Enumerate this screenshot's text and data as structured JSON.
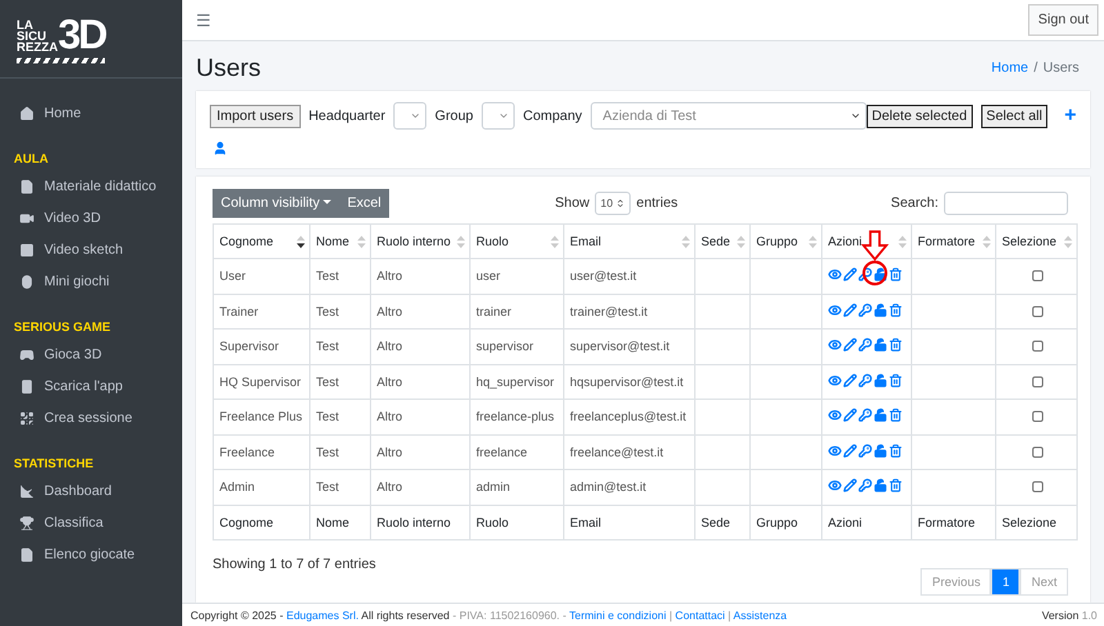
{
  "logo": {
    "lines": [
      "LA",
      "SICU",
      "REZZA"
    ],
    "mark": "3D"
  },
  "sidebar": {
    "home": {
      "label": "Home"
    },
    "sections": [
      {
        "title": "AULA",
        "items": [
          {
            "label": "Materiale didattico"
          },
          {
            "label": "Video 3D"
          },
          {
            "label": "Video sketch"
          },
          {
            "label": "Mini giochi"
          }
        ]
      },
      {
        "title": "SERIOUS GAME",
        "items": [
          {
            "label": "Gioca 3D"
          },
          {
            "label": "Scarica l'app"
          },
          {
            "label": "Crea sessione"
          }
        ]
      },
      {
        "title": "STATISTICHE",
        "items": [
          {
            "label": "Dashboard"
          },
          {
            "label": "Classifica"
          },
          {
            "label": "Elenco giocate"
          }
        ]
      }
    ]
  },
  "topbar": {
    "menu": "☰",
    "signout": "Sign out"
  },
  "page": {
    "title": "Users",
    "breadcrumb": [
      {
        "label": "Home",
        "link": true
      },
      {
        "label": "Users",
        "link": false
      }
    ],
    "separator": "/"
  },
  "filters": {
    "import": "Import users",
    "headquarter": {
      "label": "Headquarter"
    },
    "group": {
      "label": "Group"
    },
    "company": {
      "label": "Company",
      "value": "Azienda di Test"
    },
    "delete": "Delete selected",
    "select_all": "Select all",
    "add": "+"
  },
  "table_tools": {
    "buttons": [
      "Column visibility",
      "Excel"
    ],
    "show": "Show",
    "length": "10",
    "entries": "entries",
    "search": "Search:"
  },
  "table": {
    "columns": [
      {
        "label": "Cognome",
        "sorted": true
      },
      {
        "label": "Nome",
        "sorted": false
      },
      {
        "label": "Ruolo interno",
        "sorted": false
      },
      {
        "label": "Ruolo",
        "sorted": false
      },
      {
        "label": "Email",
        "sorted": false
      },
      {
        "label": "Sede",
        "sorted": false
      },
      {
        "label": "Gruppo",
        "sorted": false
      },
      {
        "label": "Azioni",
        "sorted": false
      },
      {
        "label": "Formatore",
        "sorted": false
      },
      {
        "label": "Selezione",
        "sorted": false
      }
    ],
    "rows": [
      {
        "cognome": "User",
        "nome": "Test",
        "ruolo_interno": "Altro",
        "ruolo": "user",
        "email": "user@test.it",
        "selected": false,
        "annotated": true
      },
      {
        "cognome": "Trainer",
        "nome": "Test",
        "ruolo_interno": "Altro",
        "ruolo": "trainer",
        "email": "trainer@test.it",
        "selected": false,
        "annotated": false
      },
      {
        "cognome": "Supervisor",
        "nome": "Test",
        "ruolo_interno": "Altro",
        "ruolo": "supervisor",
        "email": "supervisor@test.it",
        "selected": false,
        "annotated": false
      },
      {
        "cognome": "HQ Supervisor",
        "nome": "Test",
        "ruolo_interno": "Altro",
        "ruolo": "hq_supervisor",
        "email": "hqsupervisor@test.it",
        "selected": false,
        "annotated": false
      },
      {
        "cognome": "Freelance Plus",
        "nome": "Test",
        "ruolo_interno": "Altro",
        "ruolo": "freelance-plus",
        "email": "freelanceplus@test.it",
        "selected": false,
        "annotated": false
      },
      {
        "cognome": "Freelance",
        "nome": "Test",
        "ruolo_interno": "Altro",
        "ruolo": "freelance",
        "email": "freelance@test.it",
        "selected": false,
        "annotated": false
      },
      {
        "cognome": "Admin",
        "nome": "Test",
        "ruolo_interno": "Altro",
        "ruolo": "admin",
        "email": "admin@test.it",
        "selected": false,
        "annotated": false
      }
    ],
    "footer_columns": [
      "Cognome",
      "Nome",
      "Ruolo interno",
      "Ruolo",
      "Email",
      "Sede",
      "Gruppo",
      "Azioni",
      "Formatore",
      "Selezione"
    ],
    "info": "Showing 1 to 7 of 7 entries",
    "pagination": [
      {
        "label": "Previous",
        "selected": false
      },
      {
        "label": "1",
        "selected": true
      },
      {
        "label": "Next",
        "selected": false
      }
    ]
  },
  "footer": {
    "parts": [
      {
        "kind": "text",
        "text": "Copyright © 2025 - "
      },
      {
        "kind": "link",
        "text": "Edugames Srl."
      },
      {
        "kind": "text",
        "text": " All rights reserved"
      },
      {
        "kind": "muted",
        "text": " - PIVA: 11502160960. - "
      },
      {
        "kind": "link",
        "text": "Termini e condizioni"
      },
      {
        "kind": "muted",
        "text": " | "
      },
      {
        "kind": "link",
        "text": "Contattaci"
      },
      {
        "kind": "muted",
        "text": " | "
      },
      {
        "kind": "link",
        "text": "Assistenza"
      }
    ],
    "version_label": "Version",
    "version": "1.0"
  }
}
